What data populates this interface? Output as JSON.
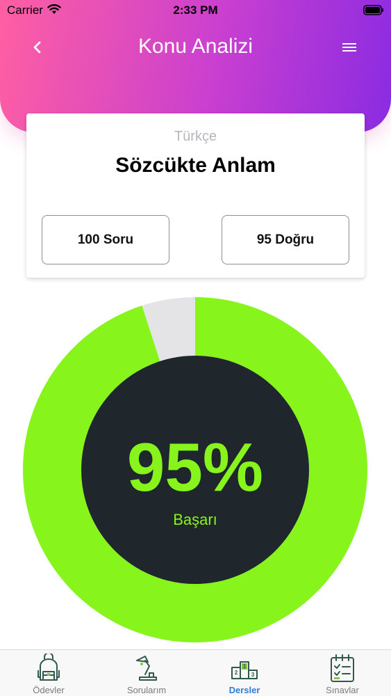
{
  "status_bar": {
    "carrier": "Carrier",
    "time": "2:33 PM"
  },
  "header": {
    "title": "Konu Analizi",
    "gradient": [
      "#ff5fa2",
      "#c93fd0",
      "#8a2be2"
    ]
  },
  "card": {
    "subject": "Türkçe",
    "topic": "Sözcükte Anlam",
    "questions_label": "100 Soru",
    "correct_label": "95 Doğru"
  },
  "gauge": {
    "percent_text": "95%",
    "caption": "Başarı",
    "value": 0.95,
    "accent_color": "#87f51c",
    "center_color": "#1f262c",
    "track_color": "#e4e4e6"
  },
  "tab_bar": {
    "tabs": [
      {
        "label": "Ödevler",
        "icon": "backpack-icon",
        "active": false
      },
      {
        "label": "Sorularım",
        "icon": "desk-lamp-icon",
        "active": false
      },
      {
        "label": "Dersler",
        "icon": "podium-icon",
        "active": true
      },
      {
        "label": "Sınavlar",
        "icon": "checklist-calendar-icon",
        "active": false
      }
    ]
  }
}
